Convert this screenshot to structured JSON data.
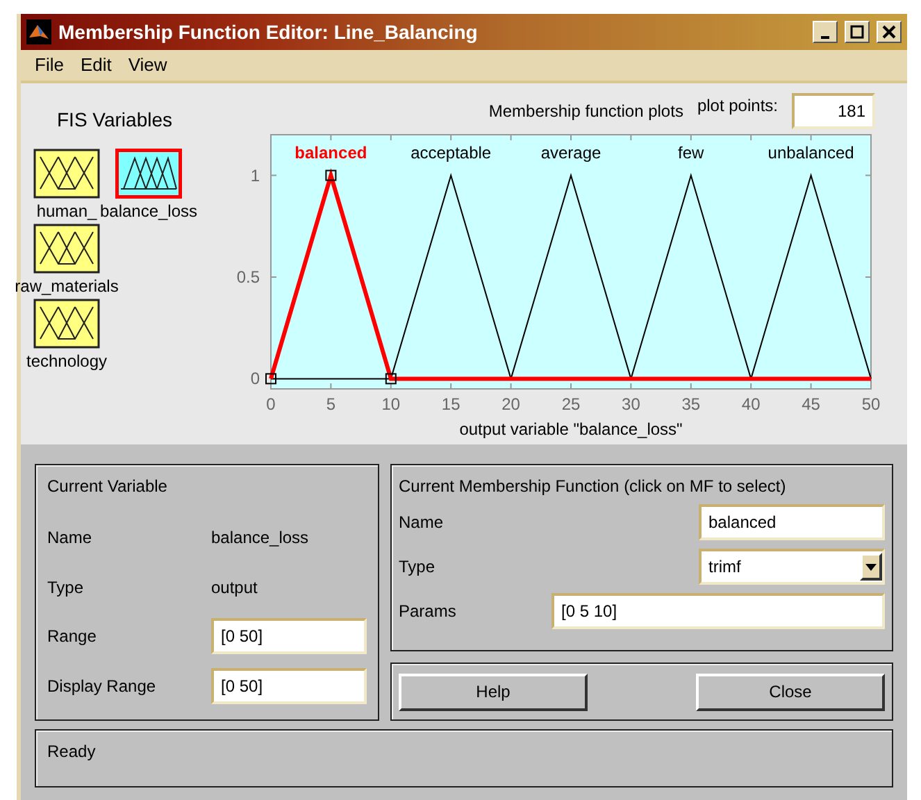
{
  "window": {
    "title": "Membership Function Editor: Line_Balancing"
  },
  "menu": [
    "File",
    "Edit",
    "View"
  ],
  "fis_variables": {
    "title": "FIS Variables",
    "items": [
      {
        "name": "human_",
        "kind": "input",
        "selected": false
      },
      {
        "name": "balance_loss",
        "kind": "output",
        "selected": true
      },
      {
        "name": "raw_materials",
        "kind": "input",
        "selected": false
      },
      {
        "name": "technology",
        "kind": "input",
        "selected": false
      }
    ]
  },
  "plot": {
    "title": "Membership function plots",
    "plot_points_label": "plot points:",
    "plot_points": "181",
    "chart_data": {
      "type": "line",
      "xlabel": "output variable \"balance_loss\"",
      "x": [
        0,
        5,
        10,
        15,
        20,
        25,
        30,
        35,
        40,
        45,
        50
      ],
      "xlim": [
        0,
        50
      ],
      "ylim": [
        -0.05,
        1.2
      ],
      "xticks": [
        0,
        5,
        10,
        15,
        20,
        25,
        30,
        35,
        40,
        45,
        50
      ],
      "yticks": [
        0,
        0.5,
        1
      ],
      "series": [
        {
          "name": "balanced",
          "color": "#ff0000",
          "values": [
            0,
            1,
            0,
            0,
            0,
            0,
            0,
            0,
            0,
            0,
            0
          ]
        },
        {
          "name": "acceptable",
          "color": "#000000",
          "values": [
            0,
            0,
            0,
            1,
            0,
            null,
            null,
            null,
            null,
            null,
            null
          ]
        },
        {
          "name": "average",
          "color": "#000000",
          "values": [
            null,
            null,
            null,
            null,
            0,
            1,
            0,
            null,
            null,
            null,
            null
          ]
        },
        {
          "name": "few",
          "color": "#000000",
          "values": [
            null,
            null,
            null,
            null,
            null,
            null,
            0,
            1,
            0,
            null,
            null
          ]
        },
        {
          "name": "unbalanced",
          "color": "#000000",
          "values": [
            null,
            null,
            null,
            null,
            null,
            null,
            null,
            null,
            0,
            1,
            0
          ]
        }
      ]
    },
    "curves": [
      {
        "selected": true
      },
      {
        "selected": false
      },
      {
        "selected": false
      },
      {
        "selected": false
      },
      {
        "selected": false
      }
    ]
  },
  "current_variable": {
    "title": "Current Variable",
    "name_label": "Name",
    "name": "balance_loss",
    "type_label": "Type",
    "type": "output",
    "range_label": "Range",
    "range": "[0 50]",
    "display_range_label": "Display Range",
    "display_range": "[0 50]"
  },
  "current_mf": {
    "title": "Current Membership Function (click on MF to select)",
    "name_label": "Name",
    "name": "balanced",
    "type_label": "Type",
    "type": "trimf",
    "params_label": "Params",
    "params": "[0 5 10]"
  },
  "buttons": [
    "Help",
    "Close"
  ],
  "status": "Ready"
}
